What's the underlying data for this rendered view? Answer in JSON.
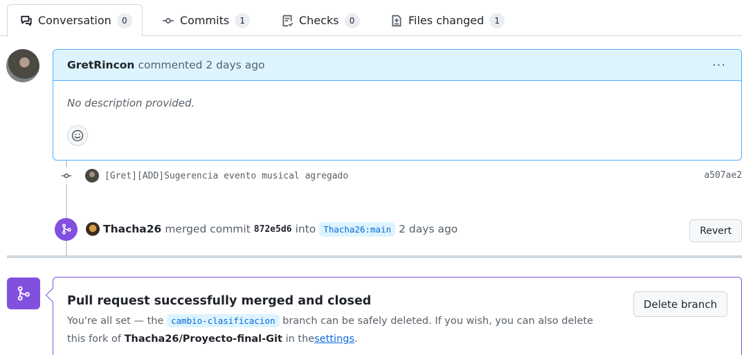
{
  "tabs": [
    {
      "label": "Conversation",
      "count": "0",
      "icon": "conversation-icon"
    },
    {
      "label": "Commits",
      "count": "1",
      "icon": "commit-icon"
    },
    {
      "label": "Checks",
      "count": "0",
      "icon": "checklist-icon"
    },
    {
      "label": "Files changed",
      "count": "1",
      "icon": "file-diff-icon"
    }
  ],
  "comment": {
    "author": "GretRincon",
    "action": "commented 2 days ago",
    "menu": "···",
    "body": "No description provided."
  },
  "commit": {
    "message": "[Gret][ADD]Sugerencia evento musical agregado",
    "sha": "a507ae2"
  },
  "merge": {
    "user": "Thacha26",
    "text_merged": "merged commit",
    "sha": "872e5d6",
    "text_into": "into",
    "branch": "Thacha26:main",
    "time": "2 days ago",
    "revert_label": "Revert"
  },
  "merged_box": {
    "title": "Pull request successfully merged and closed",
    "desc_prefix": "You're all set — the",
    "branch": "cambio-clasificacion",
    "desc_mid": "branch can be safely deleted. If you wish, you can also delete this fork of",
    "fork": "Thacha26/Proyecto-final-Git",
    "desc_in": "in the",
    "settings_link": "settings",
    "desc_end": ".",
    "delete_label": "Delete branch"
  },
  "colors": {
    "accent_blue": "#0969da",
    "merged_purple": "#8250df",
    "comment_header_bg": "#ddf4ff"
  }
}
